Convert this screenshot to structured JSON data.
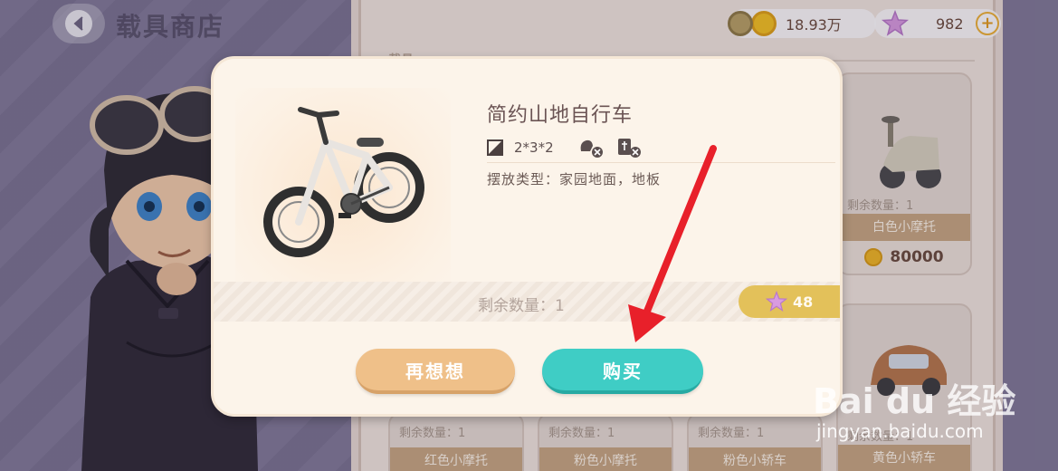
{
  "header": {
    "title": "载具商店",
    "coins": "18.93万",
    "stars": "982",
    "plus_label": "+"
  },
  "background": {
    "category_label": "载具",
    "cards": [
      {
        "remain": "剩余数量：1",
        "name": "白色小摩托",
        "price": "80000"
      },
      {
        "remain": "剩余数量：1",
        "name": "红色小摩托"
      },
      {
        "remain": "剩余数量：1",
        "name": "粉色小摩托"
      },
      {
        "remain": "剩余数量：1",
        "name": "粉色小轿车"
      },
      {
        "remain": "剩余数量：1",
        "name": "黄色小轿车"
      }
    ]
  },
  "modal": {
    "item_name": "简约山地自行车",
    "size": "2*3*2",
    "placement": "摆放类型：家园地面，地板",
    "remaining": "剩余数量：1",
    "price": "48",
    "cancel_label": "再想想",
    "buy_label": "购买"
  },
  "watermark": {
    "brand": "Bai du 经验",
    "url": "jingyan.baidu.com"
  },
  "colors": {
    "buy": "#3fcdc5",
    "cancel": "#efc089",
    "arrow": "#e8202a",
    "price_tag": "#e3c15a"
  }
}
